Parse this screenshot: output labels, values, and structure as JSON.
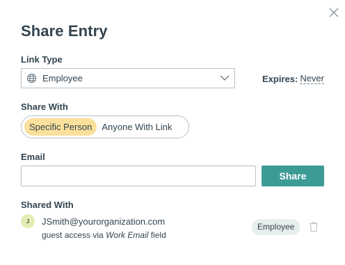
{
  "dialog": {
    "title": "Share Entry",
    "close_icon": "close-icon"
  },
  "link_type": {
    "label": "Link Type",
    "icon": "globe-icon",
    "value": "Employee"
  },
  "expires": {
    "label": "Expires:",
    "value": "Never"
  },
  "share_with": {
    "label": "Share With",
    "options": [
      "Specific Person",
      "Anyone With Link"
    ],
    "selected": "Specific Person"
  },
  "email": {
    "label": "Email",
    "value": "",
    "placeholder": ""
  },
  "share_button": {
    "label": "Share",
    "color": "#3d9b95"
  },
  "shared_with": {
    "label": "Shared With",
    "entries": [
      {
        "avatar_initial": "J",
        "email": "JSmith@yourorganization.com",
        "note_prefix": "guest access via",
        "note_field": "Work Email",
        "note_suffix": "field",
        "role": "Employee"
      }
    ]
  },
  "colors": {
    "accent": "#3d9b95",
    "selected_option": "#fbe09b",
    "avatar_bg": "#e3ecb4",
    "text": "#33444f"
  }
}
